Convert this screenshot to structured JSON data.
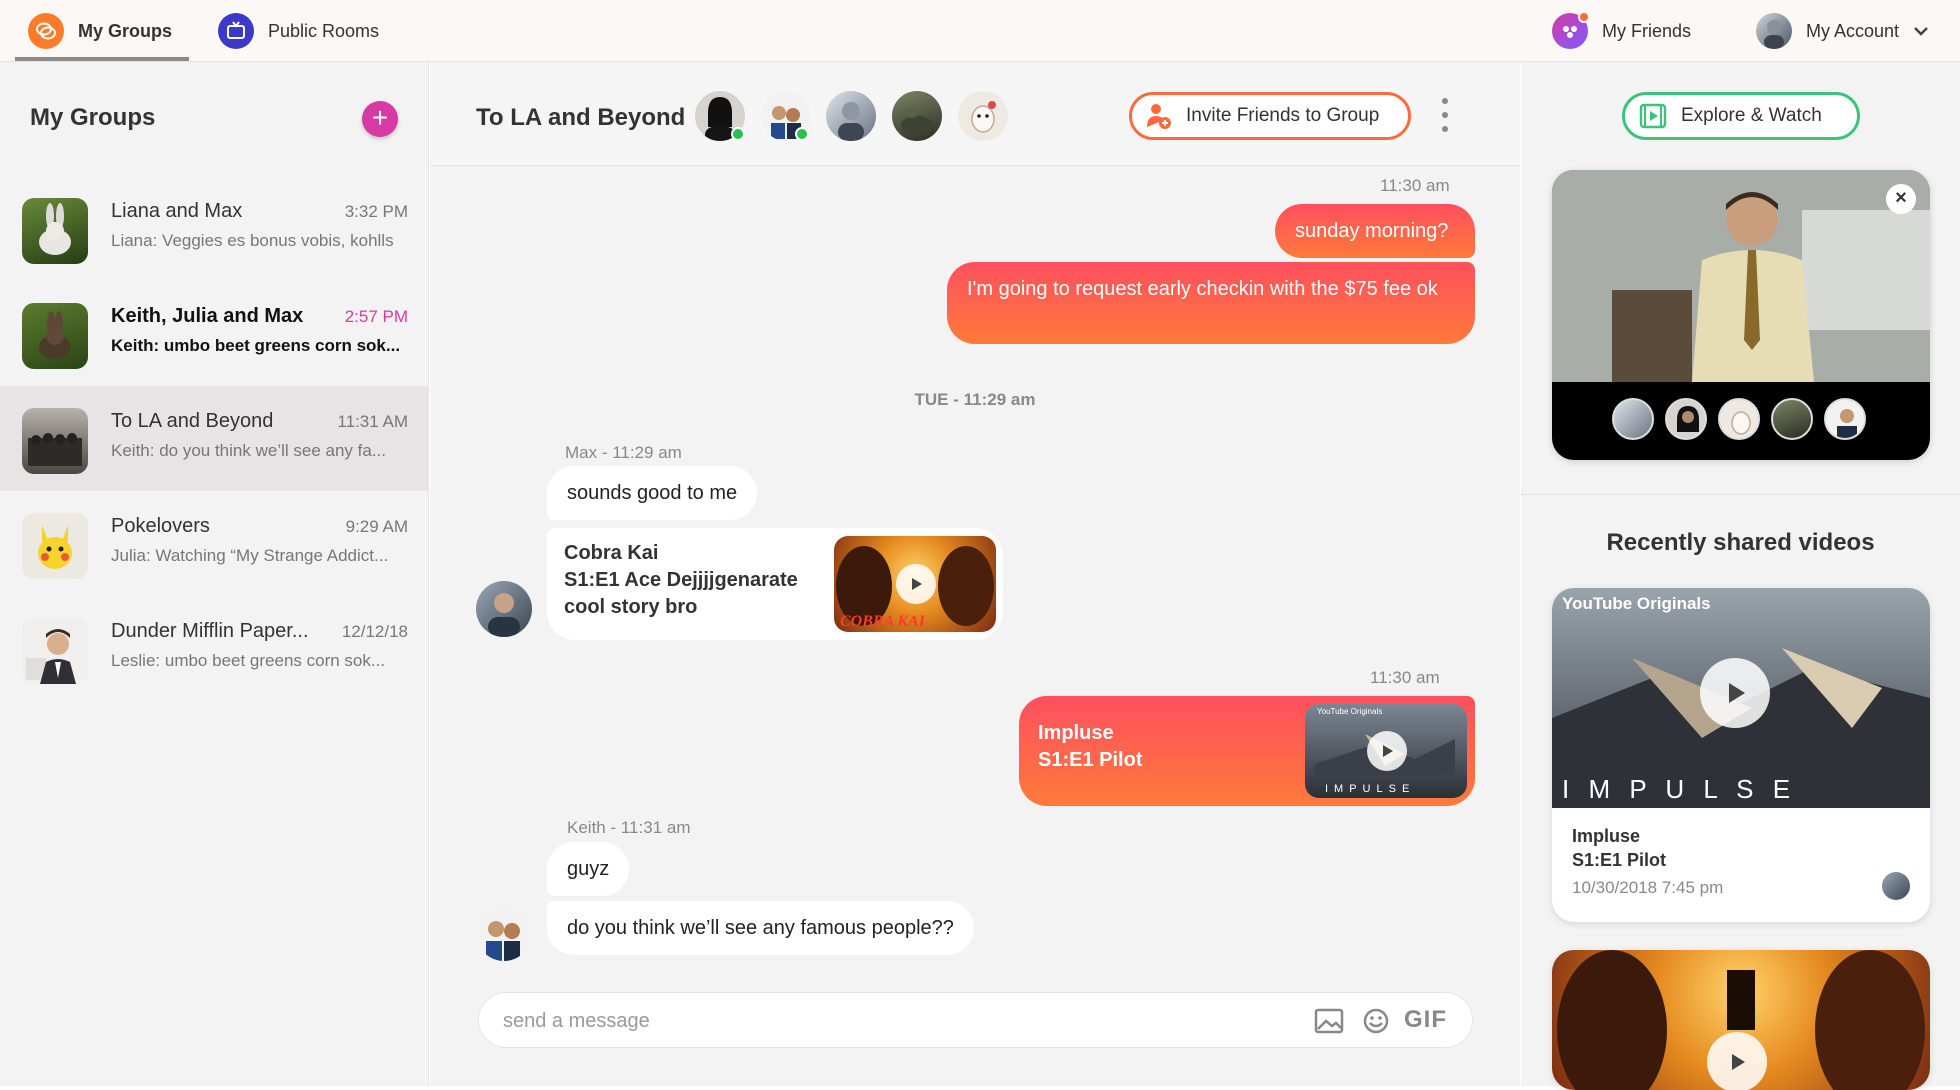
{
  "nav": {
    "tabs": [
      {
        "label": "My Groups",
        "icon": "chat-bubbles-icon",
        "color": "#ff7b2a"
      },
      {
        "label": "Public Rooms",
        "icon": "tv-icon",
        "color": "#3c39c8"
      }
    ],
    "friends_label": "My Friends",
    "account_label": "My Account"
  },
  "sidebar": {
    "title": "My Groups",
    "add_label": "+",
    "groups": [
      {
        "name": "Liana and Max",
        "time": "3:32 PM",
        "preview": "Liana: Veggies es bonus vobis, kohlls"
      },
      {
        "name": "Keith, Julia and Max",
        "time": "2:57 PM",
        "preview": "Keith: umbo beet greens corn sok...",
        "unread": true
      },
      {
        "name": "To LA and Beyond",
        "time": "11:31 AM",
        "preview": "Keith: do you think we’ll see any fa...",
        "selected": true
      },
      {
        "name": "Pokelovers",
        "time": "9:29 AM",
        "preview": "Julia: Watching “My Strange Addict..."
      },
      {
        "name": "Dunder Mifflin Paper...",
        "time": "12/12/18",
        "preview": "Leslie: umbo beet greens corn sok..."
      }
    ]
  },
  "chat": {
    "title": "To LA and Beyond",
    "invite_label": "Invite Friends to Group",
    "messages": {
      "ts1": "11:30 am",
      "out1": "sunday morning?",
      "out2": "I'm going to request early checkin with the $75 fee ok",
      "day_sep": "TUE - 11:29 am",
      "max_header": "Max - 11:29 am",
      "in1": "sounds good to me",
      "card1_title": "Cobra Kai",
      "card1_line2": "S1:E1 Ace Dejjjjgenarate",
      "card1_line3": "cool story bro",
      "ts2": "11:30 am",
      "card2_title": "Impluse",
      "card2_line2": "S1:E1 Pilot",
      "keith_header": "Keith - 11:31 am",
      "in2": "guyz",
      "in3": "do you think we’ll see any famous people??"
    },
    "composer_placeholder": "send a message",
    "gif_label": "GIF"
  },
  "right": {
    "explore_label": "Explore & Watch",
    "close_label": "×",
    "recent_title": "Recently shared videos",
    "videos": [
      {
        "banner": "YouTube Originals",
        "logo_text": "I M P U L S E",
        "title": "Impluse",
        "subtitle": "S1:E1 Pilot",
        "date": "10/30/2018 7:45 pm"
      }
    ]
  },
  "colors": {
    "accent_gradient_start": "#ff4f5e",
    "accent_gradient_end": "#ff7a3a",
    "pink": "#d83aa3",
    "green": "#3cc37b"
  }
}
